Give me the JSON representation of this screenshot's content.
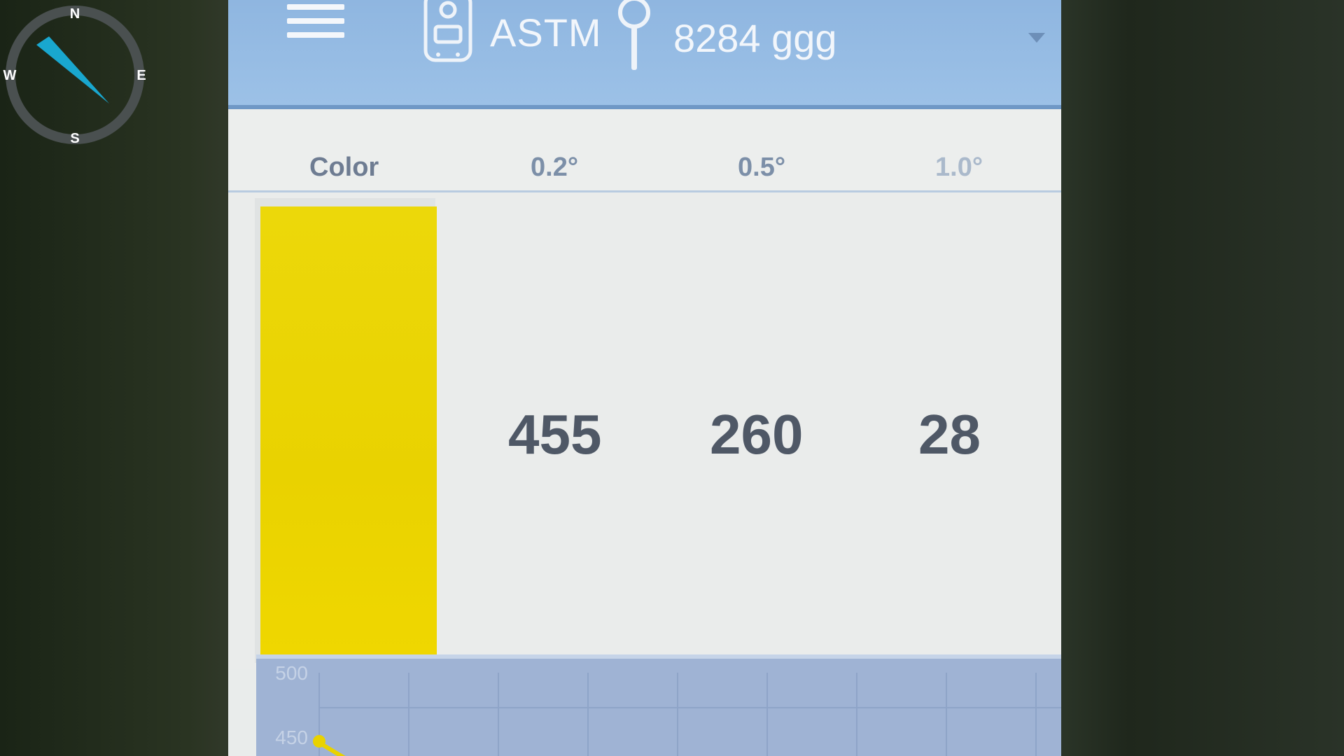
{
  "compass": {
    "n": "N",
    "s": "S",
    "e": "E",
    "w": "W"
  },
  "topbar": {
    "mode_label": "ASTM",
    "location_label": "8284 ggg"
  },
  "table": {
    "headers": [
      "Color",
      "0.2°",
      "0.5°",
      "1.0°"
    ],
    "values": [
      "455",
      "260",
      "28"
    ],
    "swatch_color": "#ebd500"
  },
  "chart": {
    "y_ticks": [
      "500",
      "450"
    ],
    "accent": "#e9d200"
  }
}
